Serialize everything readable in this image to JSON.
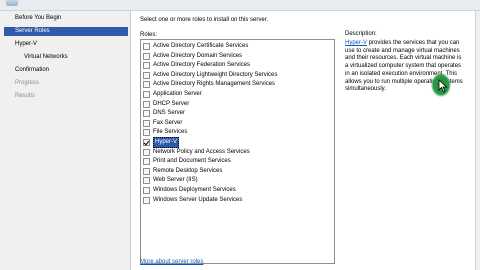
{
  "sidebar": {
    "items": [
      {
        "label": "Before You Begin",
        "state": "normal"
      },
      {
        "label": "Server Roles",
        "state": "active"
      },
      {
        "label": "Hyper-V",
        "state": "normal"
      },
      {
        "label": "Virtual Networks",
        "state": "sub"
      },
      {
        "label": "Confirmation",
        "state": "normal"
      },
      {
        "label": "Progress",
        "state": "disabled"
      },
      {
        "label": "Results",
        "state": "disabled"
      }
    ]
  },
  "main": {
    "instruction": "Select one or more roles to install on this server.",
    "roles_label": "Roles:",
    "roles": [
      {
        "label": "Active Directory Certificate Services",
        "checked": false
      },
      {
        "label": "Active Directory Domain Services",
        "checked": false
      },
      {
        "label": "Active Directory Federation Services",
        "checked": false
      },
      {
        "label": "Active Directory Lightweight Directory Services",
        "checked": false
      },
      {
        "label": "Active Directory Rights Management Services",
        "checked": false
      },
      {
        "label": "Application Server",
        "checked": false
      },
      {
        "label": "DHCP Server",
        "checked": false
      },
      {
        "label": "DNS Server",
        "checked": false
      },
      {
        "label": "Fax Server",
        "checked": false
      },
      {
        "label": "File Services",
        "checked": false
      },
      {
        "label": "Hyper-V",
        "checked": true,
        "selected": true
      },
      {
        "label": "Network Policy and Access Services",
        "checked": false
      },
      {
        "label": "Print and Document Services",
        "checked": false
      },
      {
        "label": "Remote Desktop Services",
        "checked": false
      },
      {
        "label": "Web Server (IIS)",
        "checked": false
      },
      {
        "label": "Windows Deployment Services",
        "checked": false
      },
      {
        "label": "Windows Server Update Services",
        "checked": false
      }
    ],
    "more_link": "More about server roles"
  },
  "description": {
    "heading": "Description:",
    "link": "Hyper-V",
    "text": " provides the services that you can use to create and manage virtual machines and their resources. Each virtual machine is a virtualized computer system that operates in an isolated execution environment. This allows you to run multiple operating systems simultaneously."
  },
  "colors": {
    "accent": "#2e5aa8",
    "link": "#0b58c4",
    "cursor_highlight": "#2a9a45"
  }
}
